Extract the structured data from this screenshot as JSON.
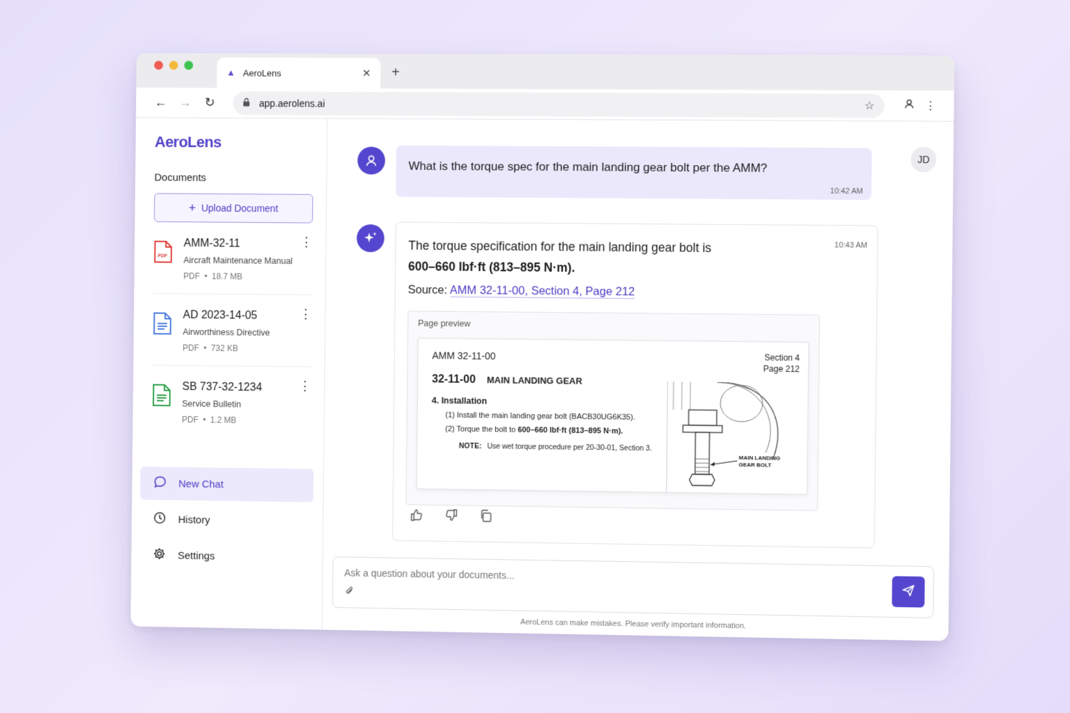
{
  "browser": {
    "tab_title": "AeroLens",
    "url": "app.aerolens.ai"
  },
  "sidebar": {
    "logo": "AeroLens",
    "documents_label": "Documents",
    "upload_label": "Upload Document",
    "documents": [
      {
        "title": "AMM-32-11",
        "subtitle": "Aircraft Maintenance Manual",
        "type": "PDF",
        "size": "18.7 MB",
        "icon": "pdf-file-icon",
        "color": "#e0403a"
      },
      {
        "title": "AD 2023-14-05",
        "subtitle": "Airworthiness Directive",
        "type": "PDF",
        "size": "732 KB",
        "icon": "document-file-icon",
        "color": "#4b7be0"
      },
      {
        "title": "SB 737-32-1234",
        "subtitle": "Service Bulletin",
        "type": "PDF",
        "size": "1.2 MB",
        "icon": "sheet-file-icon",
        "color": "#2fa04a"
      }
    ],
    "nav": [
      {
        "label": "New Chat",
        "icon": "chat-bubble-icon",
        "active": true
      },
      {
        "label": "History",
        "icon": "clock-icon",
        "active": false
      },
      {
        "label": "Settings",
        "icon": "gear-icon",
        "active": false
      }
    ]
  },
  "chat": {
    "user_initials": "JD",
    "user_message": "What is the torque spec for the main landing gear bolt per the AMM?",
    "user_time": "10:42 AM",
    "ai_time": "10:43 AM",
    "ai_text_prefix": "The torque specification for the main landing gear bolt is",
    "ai_text_bold": "600–660 lbf·ft (813–895 N·m).",
    "source_label": "Source:",
    "source_link": "AMM 32-11-00, Section 4, Page 212",
    "preview": {
      "label": "Page preview",
      "doc_id": "AMM 32-11-00",
      "section": "Section 4",
      "page": "Page 212",
      "chapter_num": "32-11-00",
      "chapter_title": "MAIN LANDING GEAR",
      "subsection": "4.   Installation",
      "step1": "(1)   Install the main landing gear bolt (BACB30UG6K35).",
      "step2_prefix": "(2)   Torque the bolt to ",
      "step2_bold": "600–660 lbf·ft (813–895 N·m).",
      "note_label": "NOTE:",
      "note_text": "Use wet torque procedure per 20-30-01, Section 3.",
      "callout": "MAIN LANDING GEAR BOLT"
    }
  },
  "composer": {
    "placeholder": "Ask a question about your documents...",
    "disclaimer": "AeroLens can make mistakes. Please verify important information."
  },
  "colors": {
    "accent": "#5546cf",
    "accent_light": "#ebe8fc"
  }
}
